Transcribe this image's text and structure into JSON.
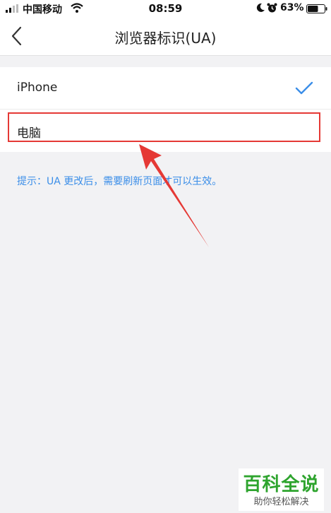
{
  "status_bar": {
    "carrier": "中国移动",
    "time": "08:59",
    "battery": "63%",
    "battery_level": 0.63
  },
  "nav": {
    "title": "浏览器标识(UA)",
    "back_icon": "chevron-left-icon"
  },
  "options": [
    {
      "label": "iPhone",
      "selected": true
    },
    {
      "label": "电脑",
      "selected": false
    }
  ],
  "hint": "提示：UA 更改后，需要刷新页面才可以生效。",
  "annotation": {
    "box_color": "#e53935",
    "arrow_color": "#e53935"
  },
  "watermark": {
    "title": "百科全说",
    "subtitle": "助你轻松解决"
  },
  "colors": {
    "accent": "#3b8ee8",
    "background": "#f2f2f4"
  }
}
